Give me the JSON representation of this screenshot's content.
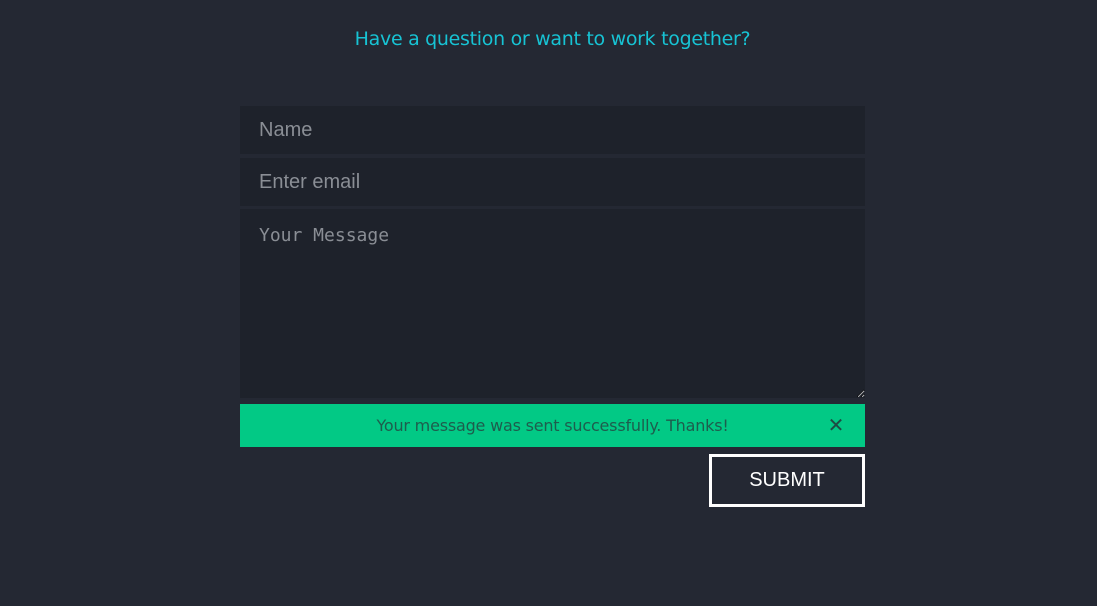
{
  "contact": {
    "heading": "Have a question or want to work together?",
    "name_placeholder": "Name",
    "email_placeholder": "Enter email",
    "message_placeholder": "Your Message",
    "alert_text": "Your message was sent successfully. Thanks!",
    "alert_close_glyph": "✕",
    "submit_label": "SUBMIT"
  },
  "colors": {
    "background": "#242833",
    "field_background": "#1e222b",
    "heading": "#17c3d4",
    "success": "#02c985",
    "button_border": "#ffffff"
  },
  "icons": {
    "alert_close": "close-icon"
  }
}
